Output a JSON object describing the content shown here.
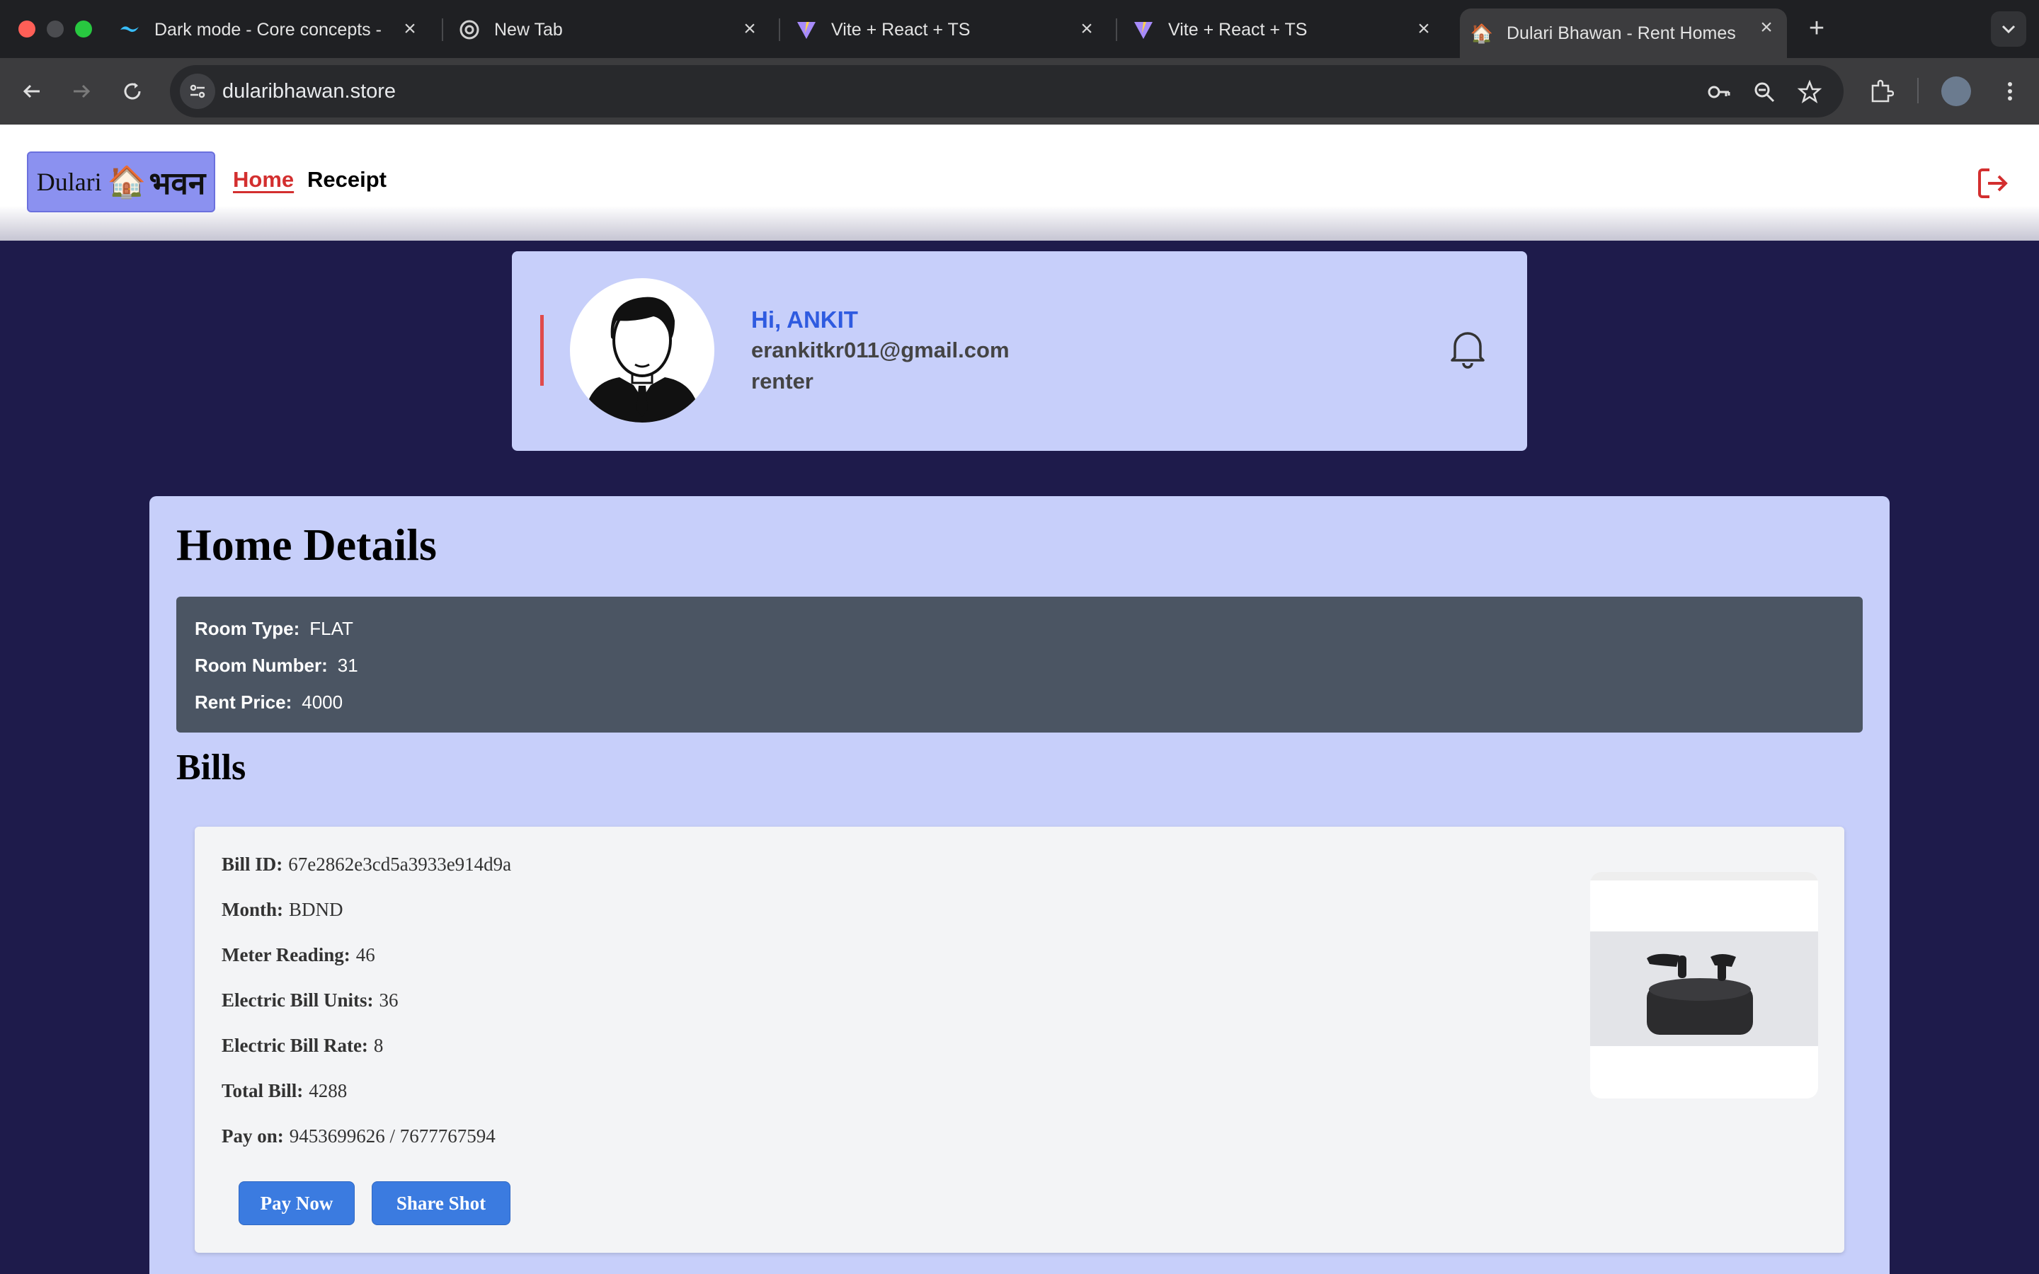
{
  "browser": {
    "tabs": [
      {
        "title": "Dark mode - Core concepts -",
        "icon": "tailwind-icon"
      },
      {
        "title": "New Tab",
        "icon": "chrome-icon"
      },
      {
        "title": "Vite + React + TS",
        "icon": "vite-icon"
      },
      {
        "title": "Vite + React + TS",
        "icon": "vite-icon"
      },
      {
        "title": "Dulari Bhawan - Rent Homes",
        "icon": "house-icon",
        "active": true
      }
    ],
    "url": "dularibhawan.store"
  },
  "header": {
    "logo": {
      "text_en": "Dulari",
      "emoji": "🏠",
      "text_hi": "भवन"
    },
    "nav": [
      {
        "label": "Home",
        "active": true
      },
      {
        "label": "Receipt",
        "active": false
      }
    ],
    "logout_icon": "logout-icon"
  },
  "profile": {
    "greeting": "Hi, ANKIT",
    "email": "erankitkr011@gmail.com",
    "role": "renter",
    "notification_icon": "bell-icon"
  },
  "home_details": {
    "title": "Home Details",
    "rows": [
      {
        "label": "Room Type:",
        "value": "FLAT"
      },
      {
        "label": "Room Number:",
        "value": "31"
      },
      {
        "label": "Rent Price:",
        "value": "4000"
      }
    ]
  },
  "bills": {
    "title": "Bills",
    "items": [
      {
        "fields": [
          {
            "label": "Bill ID:",
            "value": "67e2862e3cd5a3933e914d9a"
          },
          {
            "label": "Month:",
            "value": "BDND"
          },
          {
            "label": "Meter Reading:",
            "value": "46"
          },
          {
            "label": "Electric Bill Units:",
            "value": "36"
          },
          {
            "label": "Electric Bill Rate:",
            "value": "8"
          },
          {
            "label": "Total Bill:",
            "value": "4288"
          },
          {
            "label": "Pay on:",
            "value": "9453699626 / 7677767594"
          }
        ],
        "pay_button": "Pay Now",
        "share_button": "Share Shot"
      }
    ]
  },
  "colors": {
    "page_bg": "#1e1b4b",
    "card_bg": "#c7cffa",
    "accent_red": "#d32f2f",
    "greeting_blue": "#2f5be0",
    "button_blue": "#3b7be0"
  }
}
